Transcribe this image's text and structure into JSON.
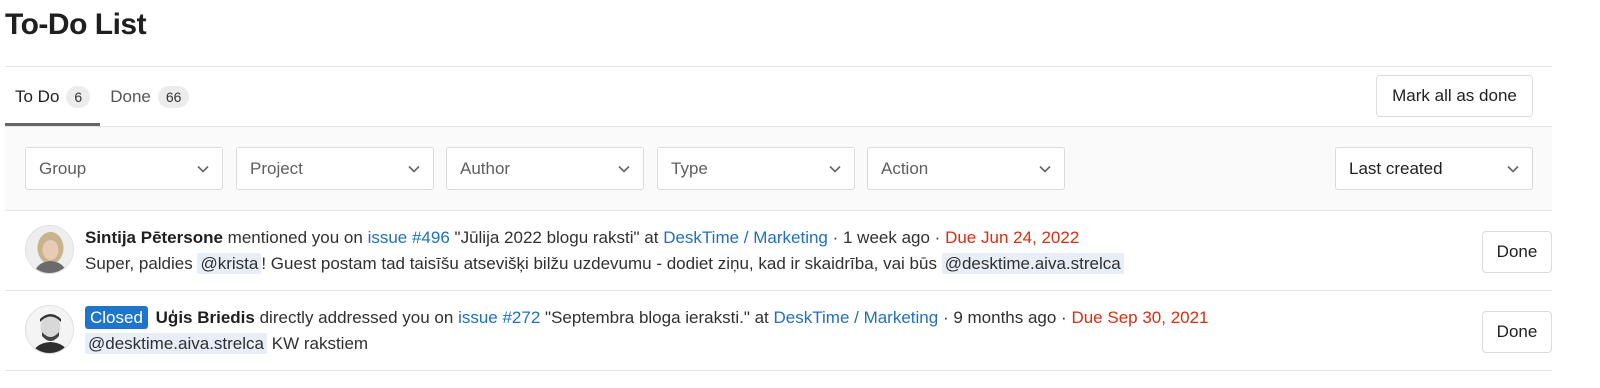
{
  "page": {
    "title": "To-Do List"
  },
  "tabs": [
    {
      "label": "To Do",
      "count": "6"
    },
    {
      "label": "Done",
      "count": "66"
    }
  ],
  "actions": {
    "mark_all_label": "Mark all as done"
  },
  "filters": {
    "group": "Group",
    "project": "Project",
    "author": "Author",
    "type": "Type",
    "action": "Action",
    "sort": "Last created"
  },
  "todos": [
    {
      "author": "Sintija Pētersone",
      "action_text": "mentioned you on",
      "target_link": "issue #496",
      "target_title": "\"Jūlija 2022 blogu raksti\" at",
      "project": "DeskTime / Marketing",
      "time": "· 1 week ago ·",
      "due": "Due Jun 24, 2022",
      "body_pre": "Super, paldies",
      "body_mention1": "@krista",
      "body_mid": "! Guest postam tad taisīšu atsevišķi bilžu uzdevumu - dodiet ziņu, kad ir skaidrība, vai būs",
      "body_mention2": "@desktime.aiva.strelca",
      "done_label": "Done"
    },
    {
      "badge": "Closed",
      "author": "Uģis Briedis",
      "action_text": "directly addressed you on",
      "target_link": "issue #272",
      "target_title": "\"Septembra bloga ieraksti.\" at",
      "project": "DeskTime / Marketing",
      "time": "· 9 months ago ·",
      "due": "Due Sep 30, 2021",
      "body_mention1": "@desktime.aiva.strelca",
      "body_post": "KW rakstiem",
      "done_label": "Done"
    }
  ],
  "icons": {
    "dropdown": "chevron-down-icon",
    "avatar": "user-avatar"
  }
}
